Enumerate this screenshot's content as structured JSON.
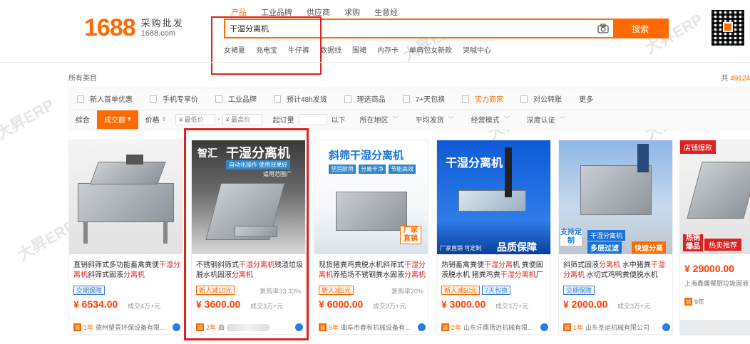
{
  "logo": {
    "brand": "1688",
    "slogan": "采购批发",
    "domain": "1688.com"
  },
  "search": {
    "tabs": [
      "产品",
      "工业品牌",
      "供应商",
      "求购",
      "生意经"
    ],
    "active_tab": "产品",
    "query": "干湿分离机",
    "button": "搜索",
    "hotwords": [
      "女裙夏",
      "充电宝",
      "牛仔裤",
      "数据线",
      "围裙",
      "内存卡",
      "单肩包女新款",
      "哭喊中心"
    ]
  },
  "breadcrumb": "所有类目",
  "result_count": {
    "prefix": "共",
    "num": "49124",
    "suffix": "件"
  },
  "filters": {
    "checks": [
      "新人首单优惠",
      "手机专享价",
      "工业品牌",
      "预计48h发货",
      "理选商品",
      "7+天包换",
      "实力商家",
      "对公转账"
    ],
    "more": "更多",
    "sort": {
      "default": "综合",
      "sales": "成交额",
      "price": "价格"
    },
    "price_low": "¥ 最低价",
    "dash": "-",
    "price_high": "¥ 最高价",
    "moq_label": "起订量",
    "moq_suffix": "以下",
    "dropdowns": [
      "所在地区",
      "平均发货",
      "经营模式",
      "深度认证"
    ]
  },
  "products": [
    {
      "title_pre": "直销斜筛式多功能畜禽粪便",
      "title_hl": "干湿分离机",
      "title_mid": "斜筛式固液",
      "title_hl2": "分离机",
      "title_post": "",
      "tags": [
        "交期保障"
      ],
      "tag_styles": [
        "blue"
      ],
      "repurchase": "",
      "price": "¥ 6534.00",
      "deal": "成交4万+元",
      "years": "1年",
      "shop": "德州望景环保设备有限..."
    },
    {
      "title_pre": "不锈钢斜筛式",
      "title_hl": "干湿分离机",
      "title_mid": "残渣垃圾脱水机固液",
      "title_hl2": "分离机",
      "title_post": "",
      "tags": [
        "新人减10元"
      ],
      "tag_styles": [
        "orange"
      ],
      "repurchase": "复购率33.33%",
      "price": "¥ 3600.00",
      "deal": "成交3万+元",
      "years": "2年",
      "shop": "曲",
      "banner": {
        "brand": "智汇",
        "name": "干湿分离机",
        "sub1": "自动化操作  使用效果好",
        "sub2": "适用范围广"
      }
    },
    {
      "title_pre": "现货猪粪鸡粪脱水机斜筛式",
      "title_hl": "干湿分离机",
      "title_mid": "养殖场不锈钢粪水固液",
      "title_hl2": "分离机",
      "title_post": "",
      "tags": [
        "新人减5元"
      ],
      "tag_styles": [
        "orange"
      ],
      "repurchase": "复购率20%",
      "price": "¥ 6000.00",
      "deal": "成交3万+元",
      "years": "5年",
      "shop": "曲阜市春秋机械设备有...",
      "banner": {
        "name": "斜筛干湿分离机",
        "chips": [
          "坚固耐用",
          "分离干净",
          "节能高效"
        ],
        "stamp": "厂家直销"
      }
    },
    {
      "title_pre": "热销畜禽粪便",
      "title_hl": "干湿分离",
      "title_mid": "机 粪便固液脱水机 猪粪鸡粪",
      "title_hl2": "干湿分离机",
      "title_post": "厂家",
      "tags": [
        "新人减50元",
        "7天包换"
      ],
      "tag_styles": [
        "orange",
        "blue"
      ],
      "repurchase": "",
      "price": "¥ 3000.00",
      "deal": "成交3万+元",
      "years": "2年",
      "shop": "山东讦鼎扬迈机械有限...",
      "banner": {
        "name": "干湿分离机",
        "bottom": "品质保障",
        "small": "厂家直销 可定制"
      }
    },
    {
      "title_pre": "斜筛式固液",
      "title_hl": "分离机",
      "title_mid": " 水中猪粪",
      "title_hl2": "干湿分离机",
      "title_post": " 水切式鸡鸭粪便脱水机",
      "tags": [
        "交期保障"
      ],
      "tag_styles": [
        "blue"
      ],
      "repurchase": "",
      "price": "¥ 2000.00",
      "deal": "成交3万+元",
      "years": "1年",
      "shop": "山东圣运机械有限公司",
      "banner": {
        "name": "干湿分离机",
        "left": "支持定制",
        "b1": "多层过滤",
        "b2": "快速分离"
      }
    }
  ],
  "partial_card": {
    "hot": "店铺爆款",
    "badge1": "热销",
    "badge2": "爆品",
    "promo": "热卖推荐",
    "price": "¥ 29000.00",
    "shop": "上海鑫螺餐厨垃圾固液",
    "years": "9年"
  },
  "watermark": "大昇ERP"
}
